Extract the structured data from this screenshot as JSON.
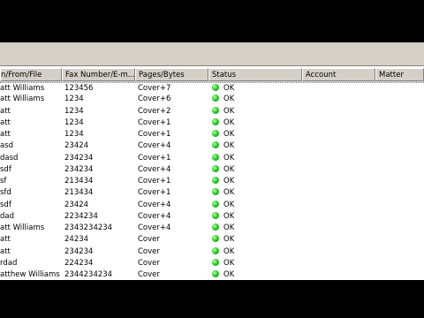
{
  "columns": [
    "n/From/File",
    "Fax Number/E-m...",
    "Pages/Bytes",
    "Status",
    "Account",
    "Matter"
  ],
  "status_ok_color": "#22c022",
  "rows": [
    {
      "from": "att Williams",
      "number": "123456",
      "pages": "Cover+7",
      "status": "OK"
    },
    {
      "from": "att Williams",
      "number": "1234",
      "pages": "Cover+6",
      "status": "OK"
    },
    {
      "from": "att",
      "number": "1234",
      "pages": "Cover+2",
      "status": "OK"
    },
    {
      "from": "att",
      "number": "1234",
      "pages": "Cover+1",
      "status": "OK"
    },
    {
      "from": "att",
      "number": "1234",
      "pages": "Cover+1",
      "status": "OK"
    },
    {
      "from": "asd",
      "number": "23424",
      "pages": "Cover+4",
      "status": "OK"
    },
    {
      "from": "dasd",
      "number": "234234",
      "pages": "Cover+1",
      "status": "OK"
    },
    {
      "from": "sdf",
      "number": "234234",
      "pages": "Cover+4",
      "status": "OK"
    },
    {
      "from": "sf",
      "number": "213434",
      "pages": "Cover+1",
      "status": "OK"
    },
    {
      "from": "sfd",
      "number": "213434",
      "pages": "Cover+1",
      "status": "OK"
    },
    {
      "from": "sdf",
      "number": "23424",
      "pages": "Cover+4",
      "status": "OK"
    },
    {
      "from": "dad",
      "number": "2234234",
      "pages": "Cover+4",
      "status": "OK"
    },
    {
      "from": "att Williams",
      "number": "2343234234",
      "pages": "Cover+4",
      "status": "OK"
    },
    {
      "from": "att",
      "number": "24234",
      "pages": "Cover",
      "status": "OK"
    },
    {
      "from": "att",
      "number": "234234",
      "pages": "Cover",
      "status": "OK"
    },
    {
      "from": "rdad",
      "number": "224234",
      "pages": "Cover",
      "status": "OK"
    },
    {
      "from": "atthew Williams",
      "number": "2344234234",
      "pages": "Cover",
      "status": "OK"
    }
  ]
}
